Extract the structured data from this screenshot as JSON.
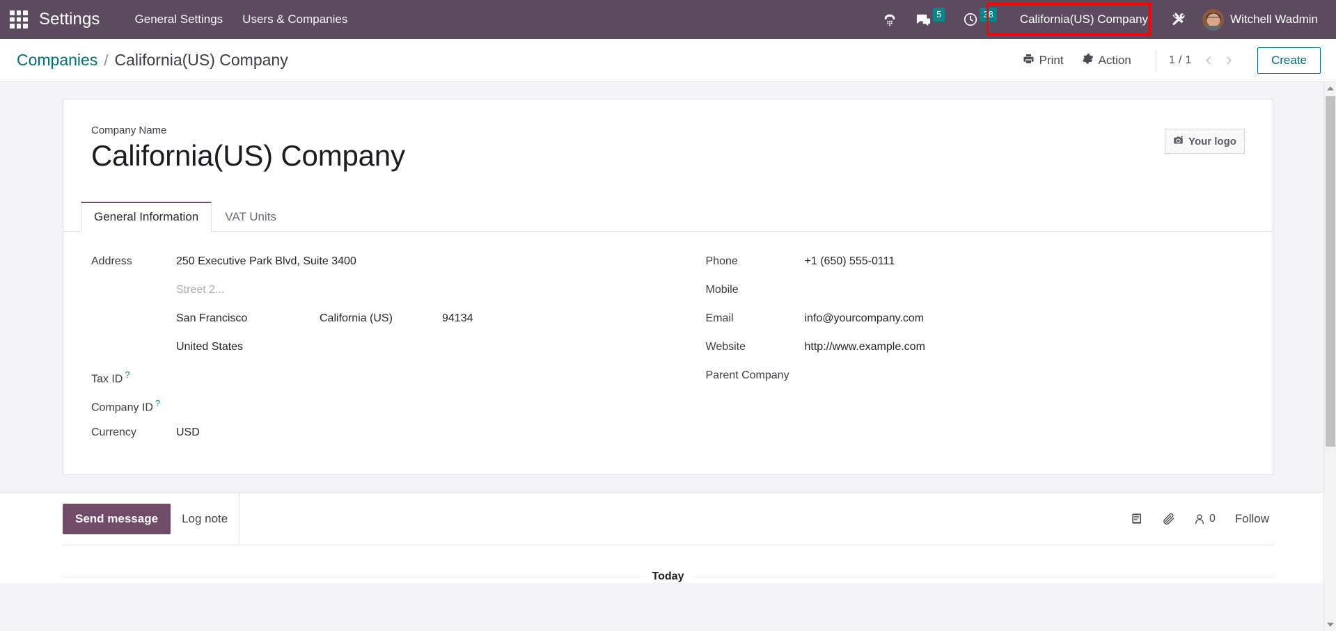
{
  "navbar": {
    "apps_icon": "apps-grid-icon",
    "brand": "Settings",
    "menu_items": [
      {
        "label": "General Settings"
      },
      {
        "label": "Users & Companies"
      }
    ],
    "sys_icons": [
      {
        "name": "voip-phone-icon",
        "badge": null
      },
      {
        "name": "messages-icon",
        "badge": "5"
      },
      {
        "name": "activities-clock-icon",
        "badge": "38"
      }
    ],
    "company_switcher": "California(US) Company",
    "debug_icon": "tools-wrench-icon",
    "user_name": "Witchell Wadmin",
    "highlight_color": "#ff0000",
    "bg_color": "#5c4a5e",
    "badge_color": "#00878a"
  },
  "control_panel": {
    "breadcrumb": {
      "parent": "Companies",
      "separator": "/",
      "current": "California(US) Company"
    },
    "print_label": "Print",
    "print_icon": "printer-icon",
    "action_label": "Action",
    "action_icon": "gear-icon",
    "pager": {
      "value": "1 / 1",
      "prev_icon": "chevron-left-icon",
      "next_icon": "chevron-right-icon"
    },
    "create_label": "Create",
    "accent_color": "#00707b"
  },
  "form": {
    "name_label": "Company Name",
    "company_name": "California(US) Company",
    "logo_placeholder": {
      "label": "Your logo",
      "icon": "camera-icon"
    },
    "tabs": [
      {
        "label": "General Information",
        "active": true
      },
      {
        "label": "VAT Units",
        "active": false
      }
    ],
    "left_fields": {
      "address_label": "Address",
      "street": "250 Executive Park Blvd, Suite 3400",
      "street2_placeholder": "Street 2...",
      "city": "San Francisco",
      "state": "California (US)",
      "zip": "94134",
      "country": "United States",
      "tax_id_label": "Tax ID",
      "tax_id_value": "",
      "company_id_label": "Company ID",
      "company_id_value": "",
      "currency_label": "Currency",
      "currency_value": "USD",
      "help_marker": "?"
    },
    "right_fields": {
      "phone_label": "Phone",
      "phone_value": "+1 (650) 555-0111",
      "mobile_label": "Mobile",
      "mobile_value": "",
      "email_label": "Email",
      "email_value": "info@yourcompany.com",
      "website_label": "Website",
      "website_value": "http://www.example.com",
      "parent_company_label": "Parent Company",
      "parent_company_value": ""
    }
  },
  "chatter": {
    "send_message_label": "Send message",
    "log_note_label": "Log note",
    "tools": [
      {
        "name": "log-book-icon",
        "label": ""
      },
      {
        "name": "attachment-paperclip-icon",
        "label": ""
      },
      {
        "name": "followers-person-icon",
        "label": "0"
      }
    ],
    "follow_label": "Follow",
    "followers_count": "0",
    "thread_date": "Today",
    "send_button_color": "#714b67"
  },
  "scrollbar": {
    "up_icon": "scroll-up-arrow-icon",
    "down_icon": "scroll-down-arrow-icon"
  }
}
